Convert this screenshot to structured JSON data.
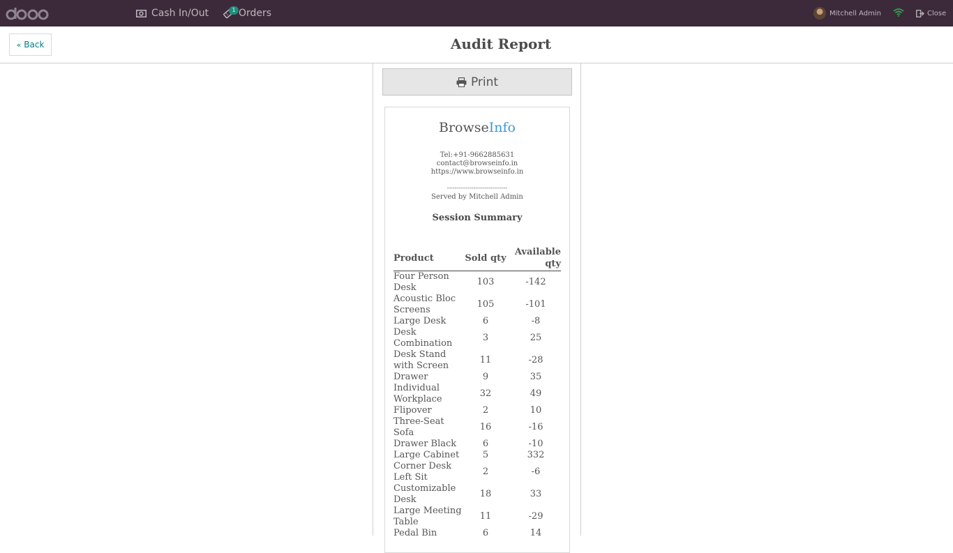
{
  "topbar": {
    "cash_label": "Cash In/Out",
    "orders_label": "Orders",
    "orders_badge": "1",
    "user_name": "Mitchell Admin",
    "close_label": "Close"
  },
  "header": {
    "back_label": "Back",
    "title": "Audit Report"
  },
  "print_label": "Print",
  "receipt": {
    "brand_part1": "Browse",
    "brand_part2": "Info",
    "tel": "Tel:+91-9662885631",
    "email": "contact@browseinfo.in",
    "website": "https://www.browseinfo.in",
    "dashes": "--------------------------------",
    "served_by": "Served by Mitchell Admin",
    "summary_title": "Session Summary",
    "columns": {
      "product": "Product",
      "sold": "Sold qty",
      "available_line1": "Available",
      "available_line2": "qty"
    },
    "rows": [
      {
        "product": "Four Person Desk",
        "sold": "103",
        "available": "-142"
      },
      {
        "product": "Acoustic Bloc Screens",
        "sold": "105",
        "available": "-101"
      },
      {
        "product": "Large Desk",
        "sold": "6",
        "available": "-8"
      },
      {
        "product": "Desk Combination",
        "sold": "3",
        "available": "25"
      },
      {
        "product": "Desk Stand with Screen",
        "sold": "11",
        "available": "-28"
      },
      {
        "product": "Drawer",
        "sold": "9",
        "available": "35"
      },
      {
        "product": "Individual Workplace",
        "sold": "32",
        "available": "49"
      },
      {
        "product": "Flipover",
        "sold": "2",
        "available": "10"
      },
      {
        "product": "Three-Seat Sofa",
        "sold": "16",
        "available": "-16"
      },
      {
        "product": "Drawer Black",
        "sold": "6",
        "available": "-10"
      },
      {
        "product": "Large Cabinet",
        "sold": "5",
        "available": "332"
      },
      {
        "product": "Corner Desk Left Sit",
        "sold": "2",
        "available": "-6"
      },
      {
        "product": "Customizable Desk",
        "sold": "18",
        "available": "33"
      },
      {
        "product": "Large Meeting Table",
        "sold": "11",
        "available": "-29"
      },
      {
        "product": "Pedal Bin",
        "sold": "6",
        "available": "14"
      }
    ]
  },
  "colors": {
    "topbar_bg": "#3c2a3b",
    "accent": "#017e84",
    "brand_info": "#3a9ad9",
    "badge": "#1e8d7c"
  }
}
